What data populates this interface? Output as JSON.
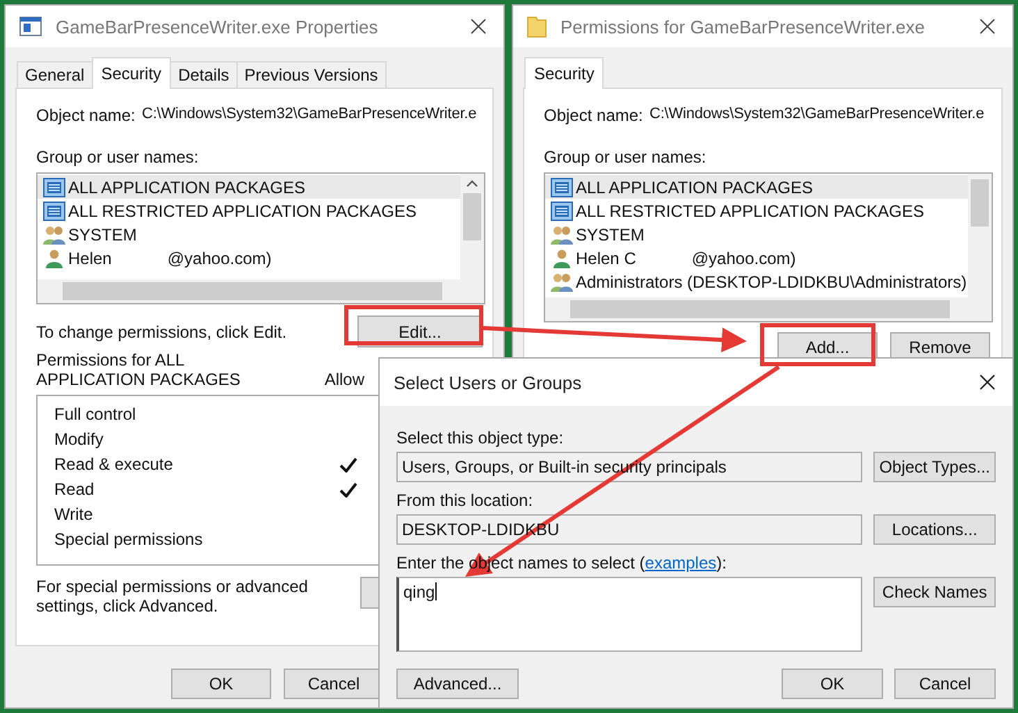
{
  "properties_window": {
    "title": "GameBarPresenceWriter.exe Properties",
    "tabs": [
      {
        "label": "General",
        "selected": false
      },
      {
        "label": "Security",
        "selected": true
      },
      {
        "label": "Details",
        "selected": false
      },
      {
        "label": "Previous Versions",
        "selected": false
      }
    ],
    "object_name_label": "Object name:",
    "object_name": "C:\\Windows\\System32\\GameBarPresenceWriter.e",
    "group_label": "Group or user names:",
    "principals": [
      {
        "kind": "package",
        "parts": [
          "ALL APPLICATION PACKAGES"
        ],
        "selected": true
      },
      {
        "kind": "package",
        "parts": [
          "ALL RESTRICTED APPLICATION PACKAGES"
        ],
        "selected": false
      },
      {
        "kind": "group",
        "parts": [
          "SYSTEM"
        ],
        "selected": false
      },
      {
        "kind": "user",
        "parts": [
          "Helen",
          "@yahoo.com)"
        ],
        "selected": false
      }
    ],
    "change_hint": "To change permissions, click Edit.",
    "edit_button": "Edit...",
    "permissions_label": "Permissions for ALL APPLICATION PACKAGES",
    "allow_header": "Allow",
    "permissions": [
      {
        "name": "Full control",
        "allow": false
      },
      {
        "name": "Modify",
        "allow": false
      },
      {
        "name": "Read & execute",
        "allow": true
      },
      {
        "name": "Read",
        "allow": true
      },
      {
        "name": "Write",
        "allow": false
      },
      {
        "name": "Special permissions",
        "allow": false
      }
    ],
    "advanced_hint": "For special permissions or advanced settings, click Advanced.",
    "buttons": [
      "OK",
      "Cancel"
    ]
  },
  "permissions_window": {
    "title": "Permissions for GameBarPresenceWriter.exe",
    "tabs": [
      {
        "label": "Security",
        "selected": true
      }
    ],
    "object_name_label": "Object name:",
    "object_name": "C:\\Windows\\System32\\GameBarPresenceWriter.e",
    "group_label": "Group or user names:",
    "principals": [
      {
        "kind": "package",
        "parts": [
          "ALL APPLICATION PACKAGES"
        ],
        "selected": true
      },
      {
        "kind": "package",
        "parts": [
          "ALL RESTRICTED APPLICATION PACKAGES"
        ],
        "selected": false
      },
      {
        "kind": "group",
        "parts": [
          "SYSTEM"
        ],
        "selected": false
      },
      {
        "kind": "user",
        "parts": [
          "Helen C",
          "@yahoo.com)"
        ],
        "selected": false
      },
      {
        "kind": "group",
        "parts": [
          "Administrators (DESKTOP-LDIDKBU\\Administrators)"
        ],
        "selected": false
      }
    ],
    "buttons": [
      "Add...",
      "Remove"
    ]
  },
  "select_dialog": {
    "title": "Select Users or Groups",
    "object_type_label": "Select this object type:",
    "object_type": "Users, Groups, or Built-in security principals",
    "object_types_button": "Object Types...",
    "location_label": "From this location:",
    "location": "DESKTOP-LDIDKBU",
    "locations_button": "Locations...",
    "names_label_before": "Enter the object names to select (",
    "names_link": "examples",
    "names_label_after": "):",
    "names_value": "qing",
    "check_names_button": "Check Names",
    "advanced_button": "Advanced...",
    "buttons": [
      "OK",
      "Cancel"
    ]
  }
}
